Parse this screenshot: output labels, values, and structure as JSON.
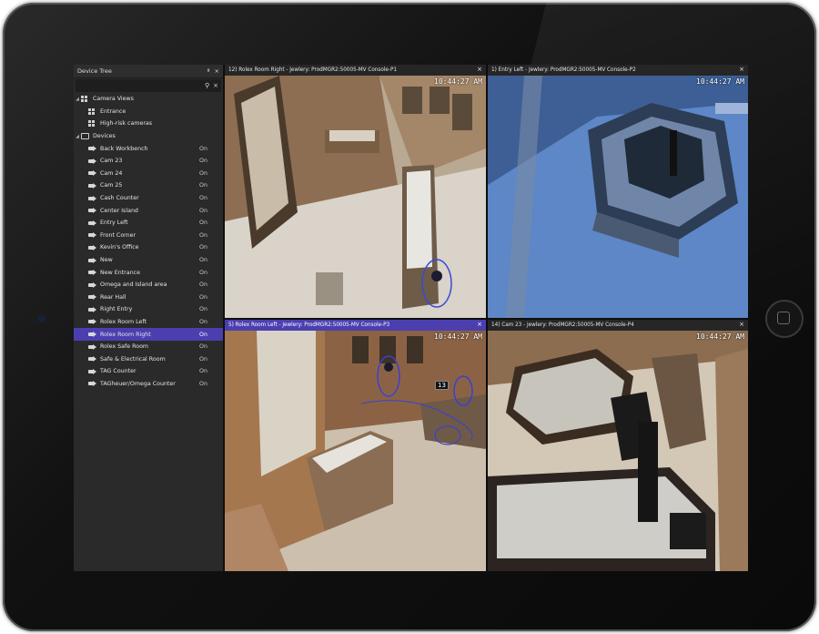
{
  "device_tree": {
    "title": "Device Tree",
    "pin_icon": "pin-icon",
    "close_icon": "close-icon",
    "search_icon": "search-icon",
    "clear_icon": "clear-icon",
    "groups": [
      {
        "label": "Camera Views",
        "icon": "camera-views-icon",
        "items": [
          {
            "label": "Entrance",
            "icon": "grid-icon"
          },
          {
            "label": "High-risk cameras",
            "icon": "grid-icon"
          }
        ]
      },
      {
        "label": "Devices",
        "icon": "folder-icon"
      }
    ],
    "devices": [
      {
        "label": "Back Workbench",
        "status": "On"
      },
      {
        "label": "Cam 23",
        "status": "On"
      },
      {
        "label": "Cam 24",
        "status": "On"
      },
      {
        "label": "Cam 25",
        "status": "On"
      },
      {
        "label": "Cash Counter",
        "status": "On"
      },
      {
        "label": "Center Island",
        "status": "On"
      },
      {
        "label": "Entry Left",
        "status": "On"
      },
      {
        "label": "Front Corner",
        "status": "On"
      },
      {
        "label": "Kevin's Office",
        "status": "On"
      },
      {
        "label": "New",
        "status": "On"
      },
      {
        "label": "New Entrance",
        "status": "On"
      },
      {
        "label": "Omega and Island area",
        "status": "On"
      },
      {
        "label": "Rear Hall",
        "status": "On"
      },
      {
        "label": "Right Entry",
        "status": "On"
      },
      {
        "label": "Rolex Room Left",
        "status": "On"
      },
      {
        "label": "Rolex Room Right",
        "status": "On",
        "selected": true
      },
      {
        "label": "Rolex Safe Room",
        "status": "On"
      },
      {
        "label": "Safe & Electrical Room",
        "status": "On"
      },
      {
        "label": "TAG Counter",
        "status": "On"
      },
      {
        "label": "TAGheuer/Omega Counter",
        "status": "On"
      }
    ]
  },
  "tiles": [
    {
      "title": "12) Rolex Room Right - Jewlery: ProdMGR2:50005-MV Console-P1",
      "timestamp": "10:44:27 AM",
      "active": false,
      "close": "×"
    },
    {
      "title": "1) Entry Left - Jewlery: ProdMGR2:50005-MV Console-P2",
      "timestamp": "10:44:27 AM",
      "active": false,
      "close": "×"
    },
    {
      "title": "5) Rolex Room Left - Jewlery: ProdMGR2:50005-MV Console-P3",
      "timestamp": "10:44:27 AM",
      "active": true,
      "close": "×",
      "overlay_label": "13"
    },
    {
      "title": "14) Cam 23 - Jewlery: ProdMGR2:50005-MV Console-P4",
      "timestamp": "10:44:27 AM",
      "active": false,
      "close": "×"
    }
  ],
  "colors": {
    "accent": "#4b3fb0",
    "panel": "#2a2a2a",
    "bezel": "#111111"
  }
}
